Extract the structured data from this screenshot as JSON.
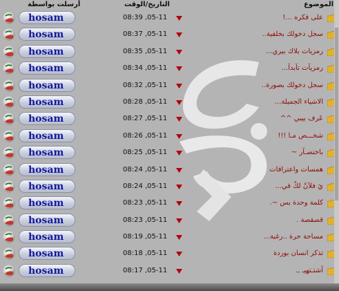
{
  "header": {
    "sender_label": "أرسلت بواسطة",
    "date_label": "التاريخ/الوقت",
    "topic_label": "الموضوع"
  },
  "colors": {
    "username": "#121a9c",
    "title": "#8e0b05",
    "arrow": "#b3010b",
    "folder": "#e3b22d"
  },
  "icons": [
    "user-avatar-icon",
    "down-arrow-icon",
    "folder-icon"
  ],
  "rows": [
    {
      "user": "hosam",
      "datetime": "08:39 ,05-11",
      "title": "على فكره ...!"
    },
    {
      "user": "hosam",
      "datetime": "08:37 ,05-11",
      "title": "سجل دخولك بخلفية.."
    },
    {
      "user": "hosam",
      "datetime": "08:35 ,05-11",
      "title": "رمزيات بلاك بيري..."
    },
    {
      "user": "hosam",
      "datetime": "08:34 ,05-11",
      "title": "رمزيآت تآبدآ..."
    },
    {
      "user": "hosam",
      "datetime": "08:32 ,05-11",
      "title": "سجل دخولك بصورة.."
    },
    {
      "user": "hosam",
      "datetime": "08:28 ,05-11",
      "title": "الاشياء الجميلة..."
    },
    {
      "user": "hosam",
      "datetime": "08:27 ,05-11",
      "title": "عَرف بيبي ^^"
    },
    {
      "user": "hosam",
      "datetime": "08:26 ,05-11",
      "title": "شخـــص مـا !!!"
    },
    {
      "user": "hosam",
      "datetime": "08:25 ,05-11",
      "title": "باختصـآر ~"
    },
    {
      "user": "hosam",
      "datetime": "08:24 ,05-11",
      "title": "همسات واعترافات"
    },
    {
      "user": "hosam",
      "datetime": "08:24 ,05-11",
      "title": "يَ فلآنْ لكْ في..."
    },
    {
      "user": "hosam",
      "datetime": "08:23 ,05-11",
      "title": "كلمة وحدة بس ~."
    },
    {
      "user": "hosam",
      "datetime": "08:23 ,05-11",
      "title": "قصقصة ."
    },
    {
      "user": "hosam",
      "datetime": "08:19 ,05-11",
      "title": "مساحة حرة ..رغبة..."
    },
    {
      "user": "hosam",
      "datetime": "08:18 ,05-11",
      "title": "تذكر انسان بوردة"
    },
    {
      "user": "hosam",
      "datetime": "08:17 ,05-11",
      "title": "آشتـتهيـ ,."
    }
  ]
}
